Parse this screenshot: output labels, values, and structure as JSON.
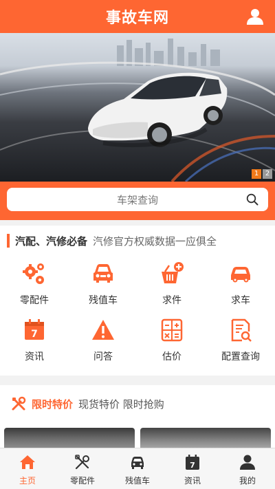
{
  "header": {
    "title": "事故车网",
    "user_icon": "user-icon"
  },
  "banner": {
    "pager": [
      "1",
      "2"
    ],
    "active_index": 0
  },
  "search": {
    "placeholder": "车架查询",
    "icon": "search-icon"
  },
  "features": {
    "title": "汽配、汽修必备",
    "subtitle": "汽修官方权威数据一应俱全",
    "items": [
      {
        "label": "零配件",
        "icon": "gears-icon"
      },
      {
        "label": "残值车",
        "icon": "car-front-icon"
      },
      {
        "label": "求件",
        "icon": "basket-plus-icon"
      },
      {
        "label": "求车",
        "icon": "car-icon"
      },
      {
        "label": "资讯",
        "icon": "calendar-icon"
      },
      {
        "label": "问答",
        "icon": "warning-icon"
      },
      {
        "label": "估价",
        "icon": "calculator-icon"
      },
      {
        "label": "配置查询",
        "icon": "document-search-icon"
      }
    ]
  },
  "flash_sale": {
    "title": "限时特价",
    "subtitle": "现货特价 限时抢购",
    "icon": "tools-icon"
  },
  "tabbar": {
    "items": [
      {
        "label": "主页",
        "icon": "home-icon"
      },
      {
        "label": "零配件",
        "icon": "tools-icon"
      },
      {
        "label": "残值车",
        "icon": "car-icon"
      },
      {
        "label": "资讯",
        "icon": "calendar-icon"
      },
      {
        "label": "我的",
        "icon": "user-icon"
      }
    ],
    "active_index": 0
  },
  "colors": {
    "brand": "#fe6632",
    "pager_active": "#f07a1a"
  }
}
